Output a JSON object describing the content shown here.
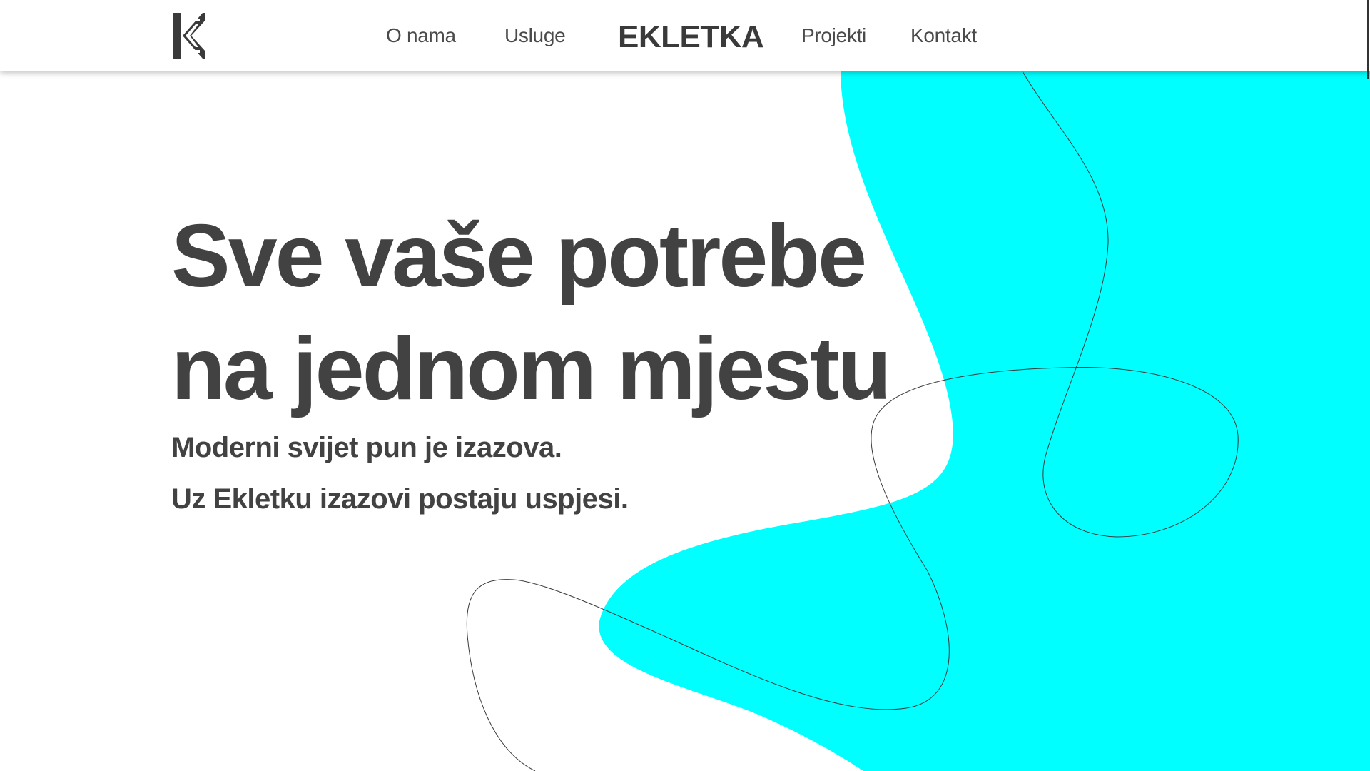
{
  "nav": {
    "logo_icon": "ekletka-logo-icon",
    "items": [
      {
        "label": "O nama"
      },
      {
        "label": "Usluge"
      },
      {
        "label": "Projekti"
      },
      {
        "label": "Kontakt"
      }
    ],
    "brand": "EKLETKA"
  },
  "hero": {
    "title_line1": "Sve vaše potrebe",
    "title_line2": "na jednom mjestu",
    "subtitle_line1": "Moderni svijet pun je izazova.",
    "subtitle_line2": "Uz Ekletku izazovi postaju uspjesi."
  },
  "colors": {
    "accent": "#00FFFF",
    "text": "#424242",
    "background": "#FFFFFF"
  }
}
